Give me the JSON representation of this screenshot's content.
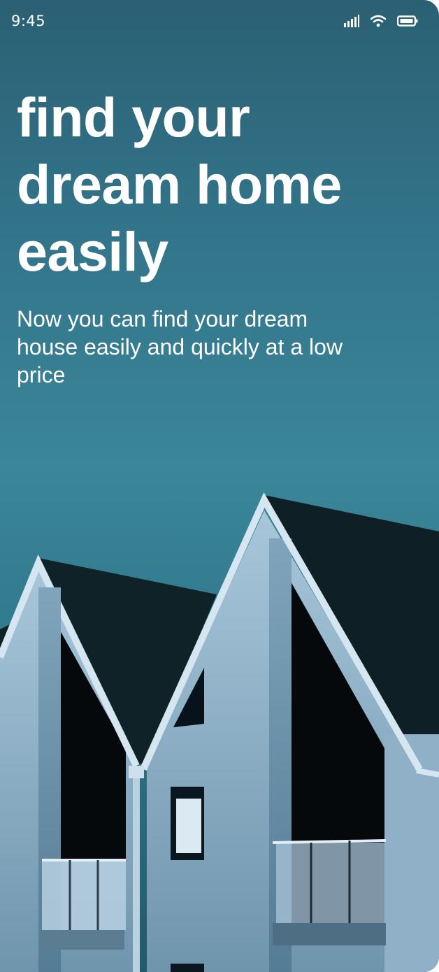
{
  "status_bar": {
    "time": "9:45",
    "icons": [
      "signal-icon",
      "wifi-icon",
      "battery-icon"
    ]
  },
  "hero": {
    "title": "find your\ndream home\neasily",
    "subtitle": "Now you can find your dream house easily and quickly at a low price"
  },
  "image": {
    "subject": "house-rooftops-photo"
  },
  "colors": {
    "background_top": "#2b6073",
    "background_mid": "#3b8699",
    "roof": "#0f2128",
    "wall": "#9bb9cf",
    "text": "#ffffff"
  }
}
